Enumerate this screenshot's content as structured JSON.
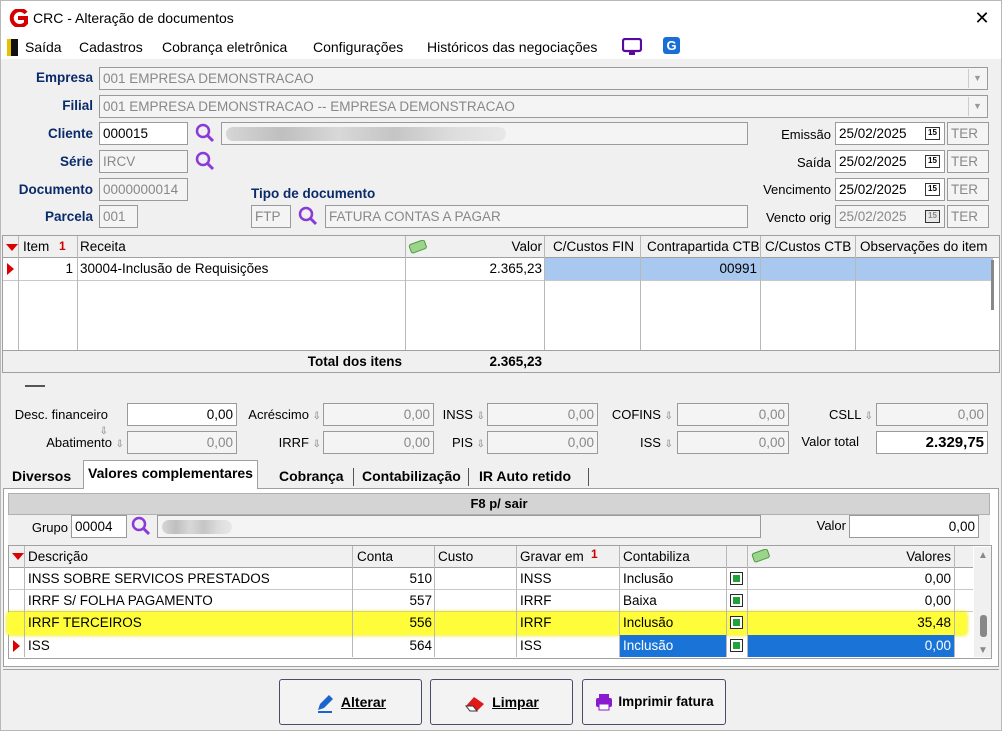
{
  "window": {
    "title": "CRC - Alteração de documentos",
    "close": "✕"
  },
  "menu": {
    "items": [
      "Saída",
      "Cadastros",
      "Cobrança eletrônica",
      "Configurações",
      "Históricos das negociações"
    ]
  },
  "header": {
    "empresa_label": "Empresa",
    "empresa_value": "001 EMPRESA DEMONSTRACAO",
    "filial_label": "Filial",
    "filial_value": "001 EMPRESA DEMONSTRACAO -- EMPRESA DEMONSTRACAO",
    "cliente_label": "Cliente",
    "cliente_value": "000015",
    "serie_label": "Série",
    "serie_value": "IRCV",
    "documento_label": "Documento",
    "documento_value": "0000000014",
    "parcela_label": "Parcela",
    "parcela_value": "001",
    "tipo_label": "Tipo de documento",
    "tipo_code": "FTP",
    "tipo_desc": "FATURA CONTAS A PAGAR",
    "emissao_label": "Emissão",
    "emissao_value": "25/02/2025",
    "emissao_day": "TER",
    "saida_label": "Saída",
    "saida_value": "25/02/2025",
    "saida_day": "TER",
    "venc_label": "Vencimento",
    "venc_value": "25/02/2025",
    "venc_day": "TER",
    "vencorig_label": "Vencto orig",
    "vencorig_value": "25/02/2025",
    "vencorig_day": "TER",
    "cal_icon_text": "15"
  },
  "items_grid": {
    "headers": {
      "item": "Item",
      "sort": "1",
      "receita": "Receita",
      "valor": "Valor",
      "ccfin": "C/Custos FIN",
      "contra": "Contrapartida CTB",
      "ccctb": "C/Custos CTB",
      "obs": "Observações do item"
    },
    "row": {
      "item": "1",
      "receita": "30004-Inclusão de Requisições",
      "valor": "2.365,23",
      "contra": "00991"
    },
    "total_label": "Total dos itens",
    "total_value": "2.365,23"
  },
  "totals": {
    "desc_fin_label": "Desc. financeiro",
    "desc_fin": "0,00",
    "acrescimo_label": "Acréscimo",
    "acrescimo": "0,00",
    "inss_label": "INSS",
    "inss": "0,00",
    "cofins_label": "COFINS",
    "cofins": "0,00",
    "csll_label": "CSLL",
    "csll": "0,00",
    "abatimento_label": "Abatimento",
    "abatimento": "0,00",
    "irrf_label": "IRRF",
    "irrf": "0,00",
    "pis_label": "PIS",
    "pis": "0,00",
    "iss_label": "ISS",
    "iss": "0,00",
    "valor_total_label": "Valor total",
    "valor_total": "2.329,75"
  },
  "tabs": [
    "Diversos",
    "Valores complementares",
    "Cobrança",
    "Contabilização",
    "IR Auto retido"
  ],
  "panel": {
    "caption": "F8 p/ sair",
    "grupo_label": "Grupo",
    "grupo_value": "00004",
    "valor_label": "Valor",
    "valor_value": "0,00",
    "headers": {
      "descricao": "Descrição",
      "conta": "Conta",
      "custo": "Custo",
      "gravar": "Gravar em",
      "sort": "1",
      "contabiliza": "Contabiliza",
      "valores": "Valores"
    },
    "rows": [
      {
        "descricao": "INSS SOBRE SERVICOS PRESTADOS",
        "conta": "510",
        "gravar": "INSS",
        "contabiliza": "Inclusão",
        "valor": "0,00"
      },
      {
        "descricao": "IRRF S/ FOLHA PAGAMENTO",
        "conta": "557",
        "gravar": "IRRF",
        "contabiliza": "Baixa",
        "valor": "0,00"
      },
      {
        "descricao": "IRRF TERCEIROS",
        "conta": "556",
        "gravar": "IRRF",
        "contabiliza": "Inclusão",
        "valor": "35,48"
      },
      {
        "descricao": "ISS",
        "conta": "564",
        "gravar": "ISS",
        "contabiliza": "Inclusão",
        "valor": "0,00"
      }
    ]
  },
  "buttons": {
    "alterar": "Alterar",
    "limpar": "Limpar",
    "imprimir": "Imprimir fatura"
  },
  "colors": {
    "accent": "#d40000",
    "selection": "#a9c8f0",
    "highlight": "#fffd3a",
    "select_blue": "#1a74d8",
    "label_blue": "#0a2a6a"
  }
}
